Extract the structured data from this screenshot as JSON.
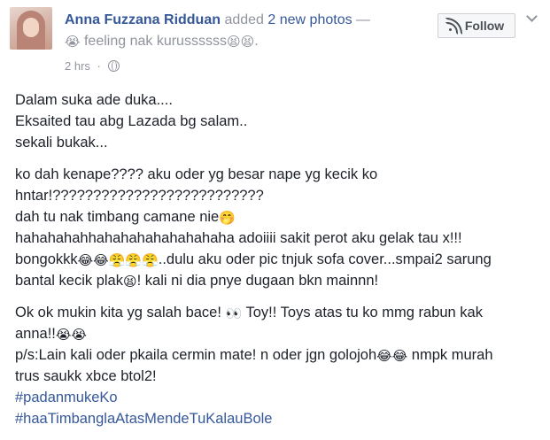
{
  "post": {
    "author": "Anna Fuzzana Ridduan",
    "action_text": "added",
    "action_link": "2 new photos",
    "action_dash": "—",
    "feeling_emoji": "😭",
    "feeling_text": "feeling nak kurussssss",
    "feeling_trailing_emoji": "😫😫",
    "feeling_period": ".",
    "timestamp": "2 hrs",
    "separator": "·",
    "privacy_icon": "globe-icon"
  },
  "follow_button": {
    "label": "Follow",
    "icon": "rss-icon"
  },
  "options": {
    "icon": "chevron-down-icon"
  },
  "body": {
    "paragraph1": [
      "Dalam suka ade duka....",
      "Eksaited tau abg Lazada bg salam..",
      "sekali bukak..."
    ],
    "paragraph2": {
      "line1": "ko dah kenape???? aku oder yg besar nape yg kecik ko",
      "line2": "hntar!??????????????????????????",
      "line3_text": "dah tu nak timbang camane nie",
      "line3_emoji": "🤭",
      "line4": "hahahahahhahahahahahahahaha adoiiii sakit perot aku gelak tau x!!!",
      "line5_text": "bongokkk",
      "line5_emoji": "😂😂😤😤😤",
      "line5_tail": "..dulu aku oder pic tnjuk sofa cover...smpai2 sarung",
      "line6_text": "bantal kecik plak",
      "line6_emoji": "😫",
      "line6_tail": "! kali ni dia pnye dugaan bkn mainnn!"
    },
    "paragraph3": {
      "line1_text": "Ok ok mukin kita yg salah bace! ",
      "line1_emoji": "👀",
      "line1_tail": " Toy!! Toys atas tu ko mmg rabun kak",
      "line2_text": "anna!!",
      "line2_emoji": "😭😭",
      "line3_text": "p/s:Lain kali oder pkaila cermin mate! n oder jgn golojoh",
      "line3_emoji": "😂😂",
      "line3_tail": " nmpk murah",
      "line4": "trus saukk xbce btol2!",
      "hashtag1": "#padanmukeKo",
      "hashtag2": "#haaTimbanglaAtasMendeTuKalauBole"
    }
  },
  "colors": {
    "link": "#365899",
    "text": "#1d2129",
    "muted": "#90949c",
    "button_bg": "#f6f7f9",
    "button_border": "#ced0d4"
  }
}
